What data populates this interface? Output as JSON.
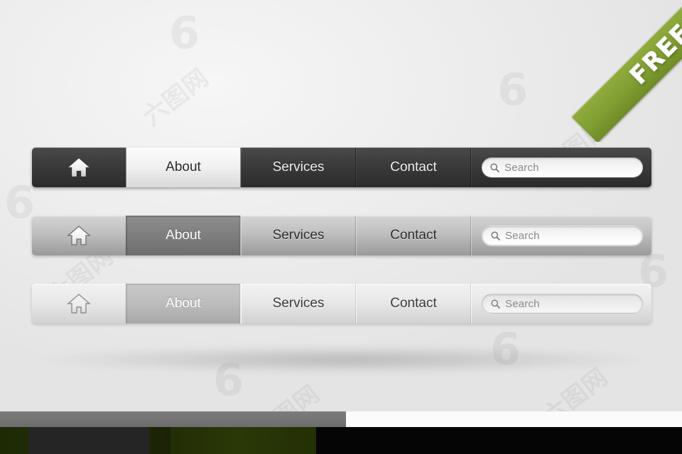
{
  "background": {
    "watermarks": [
      "6",
      "6",
      "6",
      "6",
      "6",
      "6",
      "六图网",
      "六图网",
      "六图网",
      "六图网",
      "六图网"
    ]
  },
  "ribbon": {
    "label": "FREE!",
    "color": "#82a033",
    "text_color": "#ffffff"
  },
  "navbars": [
    {
      "variant": "dark",
      "home": {
        "icon": "home-icon",
        "label": "Home"
      },
      "tabs": [
        {
          "label": "About",
          "active": true
        },
        {
          "label": "Services",
          "active": false
        },
        {
          "label": "Contact",
          "active": false
        }
      ],
      "search": {
        "icon": "search-icon",
        "placeholder": "Search",
        "value": ""
      }
    },
    {
      "variant": "medium",
      "home": {
        "icon": "home-icon",
        "label": "Home"
      },
      "tabs": [
        {
          "label": "About",
          "active": true
        },
        {
          "label": "Services",
          "active": false
        },
        {
          "label": "Contact",
          "active": false
        }
      ],
      "search": {
        "icon": "search-icon",
        "placeholder": "Search",
        "value": ""
      }
    },
    {
      "variant": "light",
      "home": {
        "icon": "home-icon",
        "label": "Home"
      },
      "tabs": [
        {
          "label": "About",
          "active": true
        },
        {
          "label": "Services",
          "active": false
        },
        {
          "label": "Contact",
          "active": false
        }
      ],
      "search": {
        "icon": "search-icon",
        "placeholder": "Search",
        "value": ""
      }
    }
  ],
  "colors": {
    "dark_bar": "#3c3c3c",
    "medium_bar": "#bfbfbf",
    "light_bar": "#e8e8e8",
    "page_background": "#eeeeee",
    "ribbon_green": "#82a033",
    "bottom_gray": "#737373",
    "bottom_green": "#2a3806",
    "bottom_black": "#050505"
  }
}
